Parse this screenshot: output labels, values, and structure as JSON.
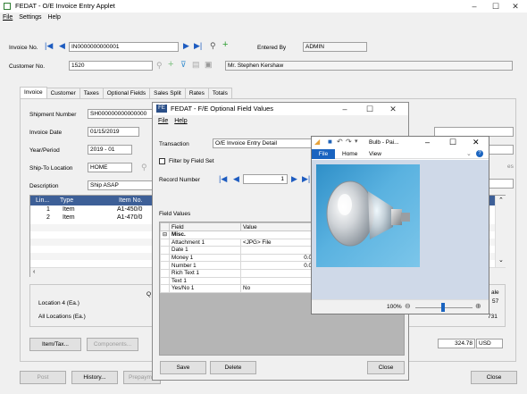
{
  "main": {
    "title": "FEDAT - O/E Invoice Entry Applet",
    "menu": [
      "File",
      "Settings",
      "Help"
    ],
    "invoice_no_label": "Invoice No.",
    "invoice_no": "IN0000000000001",
    "entered_by_label": "Entered By",
    "entered_by": "ADMIN",
    "customer_no_label": "Customer No.",
    "customer_no": "1520",
    "customer_name": "Mr. Stephen Kershaw",
    "tabs": [
      "Invoice",
      "Customer",
      "Taxes",
      "Optional Fields",
      "Sales Split",
      "Rates",
      "Totals"
    ],
    "shipment_number_label": "Shipment Number",
    "shipment_number": "SH000000000000000",
    "invoice_date_label": "Invoice Date",
    "invoice_date": "01/15/2019",
    "year_period_label": "Year/Period",
    "year_period": "2019 - 01",
    "ship_to_label": "Ship-To Location",
    "ship_to": "HOME",
    "description_label": "Description",
    "description": "Ship ASAP",
    "grid_headers": [
      "Lin...",
      "Type",
      "Item No."
    ],
    "grid_rows": [
      {
        "line": "1",
        "type": "Item",
        "item": "A1-450/0"
      },
      {
        "line": "2",
        "type": "Item",
        "item": "A1-470/0"
      }
    ],
    "location_label": "Location  4 (Ea.)",
    "all_locations_label": "All Locations (Ea.)",
    "q_label": "Q",
    "right_labels": [
      "ale",
      "57",
      "731"
    ],
    "right_partial": "es",
    "item_tax_button": "Item/Tax...",
    "components_button": "Components...",
    "total": "324.78",
    "currency": "USD",
    "post_button": "Post",
    "history_button": "History...",
    "prepayment_button": "Prepaym",
    "close_button": "Close"
  },
  "optional": {
    "title": "FEDAT - F/E Optional Field Values",
    "menu": [
      "File",
      "Help"
    ],
    "transaction_label": "Transaction",
    "transaction": "O/E Invoice Entry Detail",
    "filter_label": "Filter by Field Set",
    "record_number_label": "Record Number",
    "record_number": "1",
    "field_values_label": "Field Values",
    "headers": [
      "Field",
      "Value"
    ],
    "group": "Misc.",
    "rows": [
      {
        "field": "Attachment 1",
        "value": "<JPG> File"
      },
      {
        "field": "Date 1",
        "value": ""
      },
      {
        "field": "Money 1",
        "value": "0.000"
      },
      {
        "field": "Number 1",
        "value": "0.000"
      },
      {
        "field": "Rich Text 1",
        "value": ""
      },
      {
        "field": "Text 1",
        "value": ""
      },
      {
        "field": "Yes/No 1",
        "value": "No"
      }
    ],
    "save_button": "Save",
    "delete_button": "Delete",
    "close_button": "Close"
  },
  "paint": {
    "title": "Bulb - Pai...",
    "tabs": [
      "File",
      "Home",
      "View"
    ],
    "zoom": "100%"
  }
}
